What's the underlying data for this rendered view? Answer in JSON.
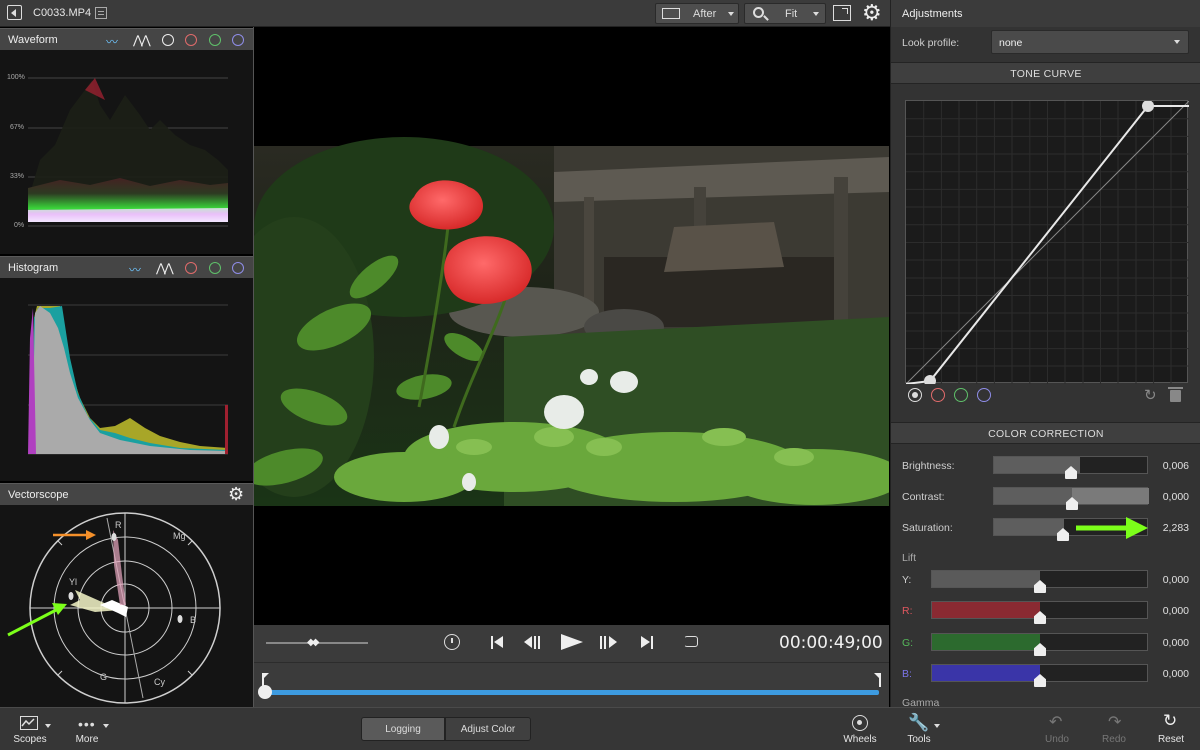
{
  "topbar": {
    "file_name": "C0033.MP4",
    "compare_mode": "After",
    "zoom_level": "Fit"
  },
  "scopes": {
    "waveform": {
      "title": "Waveform",
      "grid_labels": [
        "100%",
        "67%",
        "33%",
        "0%"
      ]
    },
    "histogram": {
      "title": "Histogram"
    },
    "vectorscope": {
      "title": "Vectorscope",
      "targets": [
        "R",
        "Mg",
        "Yl",
        "B",
        "G",
        "Cy"
      ]
    }
  },
  "transport": {
    "timecode": "00:00:49;00"
  },
  "adjustments": {
    "title": "Adjustments",
    "look_profile_label": "Look profile:",
    "look_profile_value": "none",
    "tone_curve_header": "TONE CURVE",
    "color_correction_header": "COLOR CORRECTION",
    "sliders": [
      {
        "label": "Brightness:",
        "value": "0,006",
        "fill": 0.556
      },
      {
        "label": "Contrast:",
        "value": "0,000",
        "fill": 0.5
      },
      {
        "label": "Saturation:",
        "value": "2,283",
        "fill": 0.455
      }
    ],
    "lift_label": "Lift",
    "lift": [
      {
        "label": "Y:",
        "value": "0,000",
        "fill": 0.5,
        "color": "#5a5a5a",
        "label_color": "#cfcfcf"
      },
      {
        "label": "R:",
        "value": "0,000",
        "fill": 0.5,
        "color": "#8a2a32",
        "label_color": "#e0575f"
      },
      {
        "label": "G:",
        "value": "0,000",
        "fill": 0.5,
        "color": "#2c6a2e",
        "label_color": "#55b85a"
      },
      {
        "label": "B:",
        "value": "0,000",
        "fill": 0.5,
        "color": "#3a35a8",
        "label_color": "#7b74e8"
      }
    ],
    "gamma_label": "Gamma"
  },
  "bottombar": {
    "scopes_label": "Scopes",
    "more_label": "More",
    "tab_logging": "Logging",
    "tab_adjust": "Adjust Color",
    "wheels_label": "Wheels",
    "tools_label": "Tools",
    "undo_label": "Undo",
    "redo_label": "Redo",
    "reset_label": "Reset"
  },
  "colors": {
    "timeline_bar": "#3d9be0",
    "channel_red": "#e06b6b",
    "channel_green": "#5fc06a",
    "channel_blue": "#8f8de8",
    "annotation_green": "#7cff1a",
    "annotation_orange": "#f5902a"
  }
}
